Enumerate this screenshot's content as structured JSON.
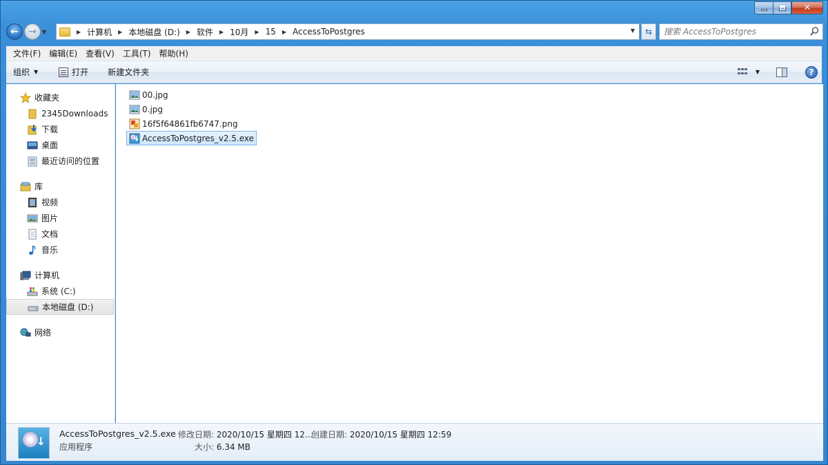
{
  "address": {
    "crumbs": [
      "计算机",
      "本地磁盘 (D:)",
      "软件",
      "10月",
      "15",
      "AccessToPostgres"
    ]
  },
  "search": {
    "placeholder": "搜索 AccessToPostgres"
  },
  "menu": [
    "文件(F)",
    "编辑(E)",
    "查看(V)",
    "工具(T)",
    "帮助(H)"
  ],
  "toolbar": {
    "organize": "组织",
    "open": "打开",
    "new_folder": "新建文件夹"
  },
  "sidebar": {
    "favorites": {
      "label": "收藏夹",
      "items": [
        "2345Downloads",
        "下载",
        "桌面",
        "最近访问的位置"
      ]
    },
    "libraries": {
      "label": "库",
      "items": [
        "视频",
        "图片",
        "文档",
        "音乐"
      ]
    },
    "computer": {
      "label": "计算机",
      "items": [
        "系统 (C:)",
        "本地磁盘 (D:)"
      ]
    },
    "network": {
      "label": "网络"
    }
  },
  "files": [
    {
      "name": "00.jpg",
      "icon": "image-file-icon"
    },
    {
      "name": "0.jpg",
      "icon": "image-file-icon"
    },
    {
      "name": "16f5f64861fb6747.png",
      "icon": "png-file-icon"
    },
    {
      "name": "AccessToPostgres_v2.5.exe",
      "icon": "exe-file-icon"
    }
  ],
  "details": {
    "name": "AccessToPostgres_v2.5.exe",
    "type": "应用程序",
    "modified_label": "修改日期:",
    "modified_value": "2020/10/15 星期四 12...",
    "created_label": "创建日期:",
    "created_value": "2020/10/15 星期四 12:59",
    "size_label": "大小:",
    "size_value": "6.34 MB"
  },
  "colors": {
    "frame": "#3a8fd8",
    "selection": "#cde6fb",
    "selection_border": "#7db3e8"
  }
}
